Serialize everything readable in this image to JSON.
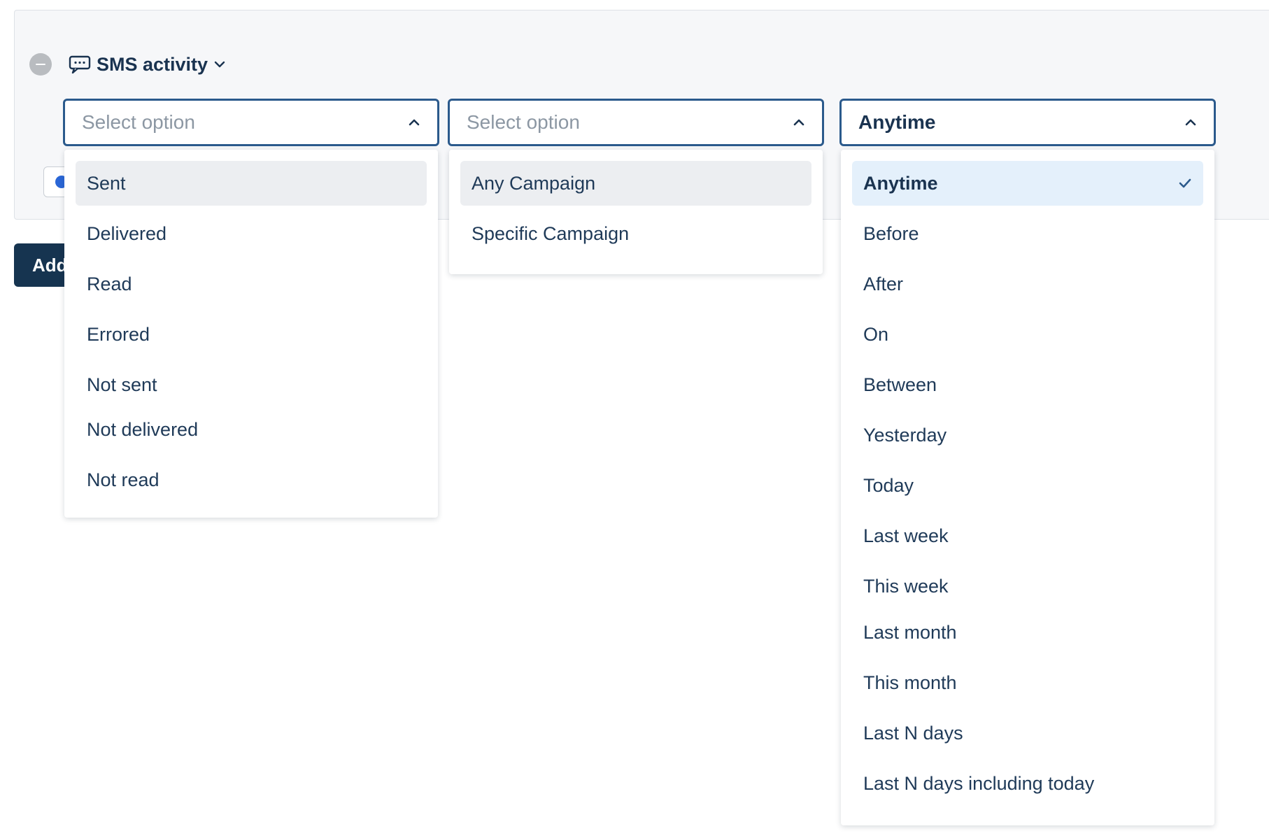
{
  "filter": {
    "title": "SMS activity",
    "add_button_label": "Add"
  },
  "selects": {
    "status": {
      "placeholder": "Select option",
      "options": [
        "Sent",
        "Delivered",
        "Read",
        "Errored",
        "Not sent",
        "Not delivered",
        "Not read"
      ],
      "highlighted": "Sent"
    },
    "campaign": {
      "placeholder": "Select option",
      "options": [
        "Any Campaign",
        "Specific Campaign"
      ],
      "highlighted": "Any Campaign"
    },
    "time": {
      "value": "Anytime",
      "options": [
        "Anytime",
        "Before",
        "After",
        "On",
        "Between",
        "Yesterday",
        "Today",
        "Last week",
        "This week",
        "Last month",
        "This month",
        "Last N days",
        "Last N days including today"
      ],
      "selected": "Anytime"
    }
  },
  "colors": {
    "select_border": "#2b5a8c",
    "primary_button": "#163450",
    "selected_option_bg": "#e4f0fb",
    "hover_option_bg": "#eceef1",
    "text": "#1f3a58"
  },
  "icons": {
    "remove": "minus-circle-icon",
    "sms": "chat-bubble-icon",
    "title_chevron": "chevron-down-icon",
    "select_chevron": "chevron-up-icon",
    "check": "check-icon"
  }
}
